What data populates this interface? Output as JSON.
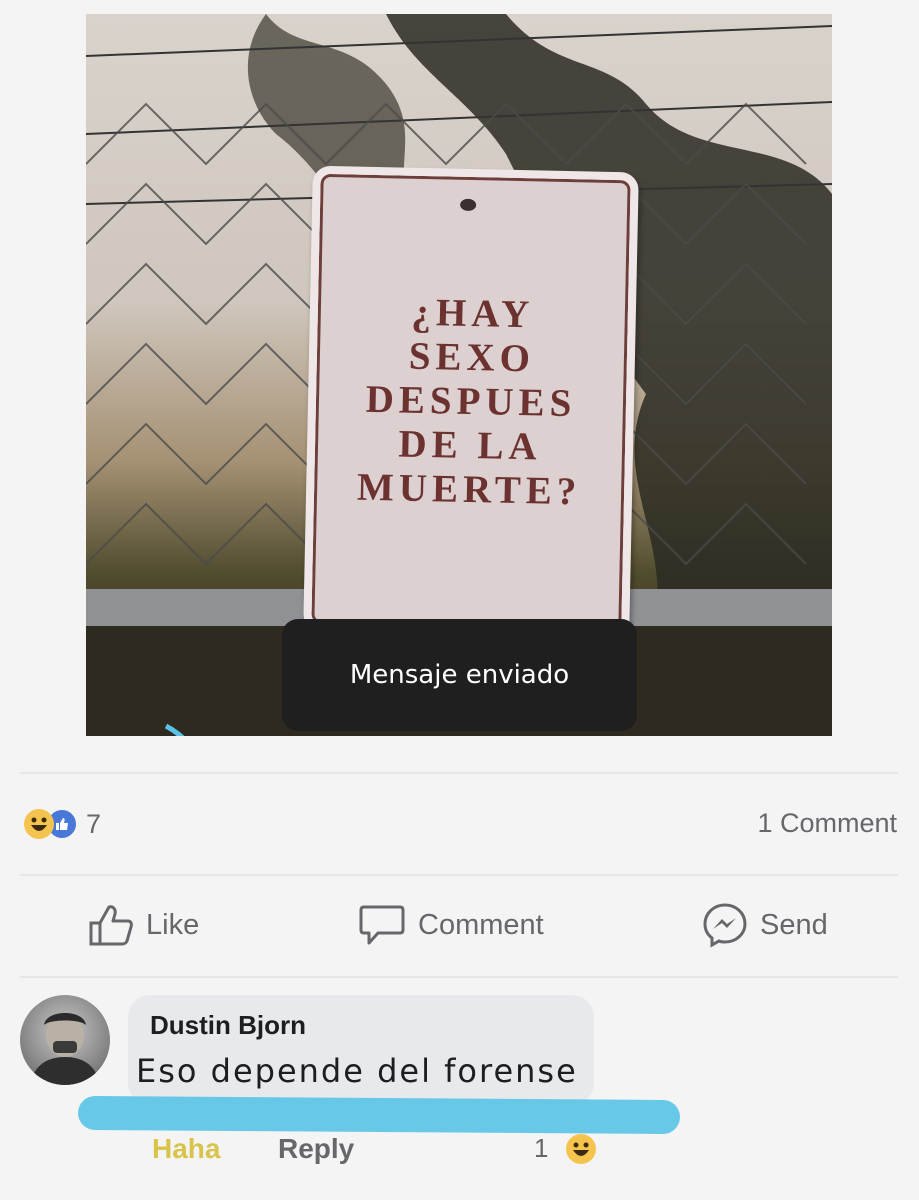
{
  "post": {
    "image": {
      "sign_text": "¿HAY\nSEXO\nDESPUES\nDE LA\nMUERTE?",
      "toast_message": "Mensaje enviado"
    },
    "reactions": {
      "icons": [
        "haha-icon",
        "like-icon"
      ],
      "count": "7"
    },
    "comments_count_label": "1 Comment",
    "actions": {
      "like": "Like",
      "comment": "Comment",
      "send": "Send"
    }
  },
  "comment": {
    "author": "Dustin Bjorn",
    "text": "Eso depende del forense",
    "haha_label": "Haha",
    "reply_label": "Reply",
    "reaction_count": "1"
  },
  "colors": {
    "background": "#f4f4f5",
    "sign_text": "#6b3230",
    "toast_bg": "#1f1f1f",
    "muted_text": "#65676b",
    "highlight_scribble": "#5bc3e6"
  }
}
